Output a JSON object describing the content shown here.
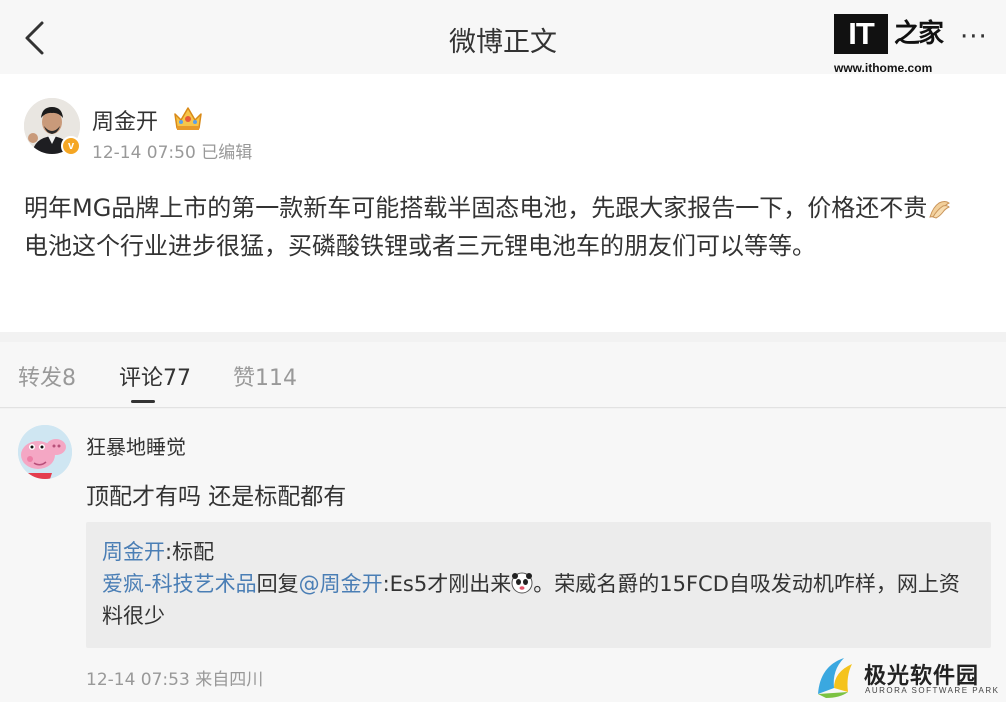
{
  "nav": {
    "title": "微博正文",
    "more_label": "···"
  },
  "watermark_top": {
    "logo_text": "IT",
    "logo_chars": "之家",
    "url": "www.ithome.com"
  },
  "post": {
    "author": "周金开",
    "meta": "12-14 07:50 已编辑",
    "line1": "明年MG品牌上市的第一款新车可能搭载半固态电池，先跟大家报告一下，价格还不贵",
    "line2": "电池这个行业进步很猛，买磷酸铁锂或者三元锂电池车的朋友们可以等等。",
    "verified_badge": "v"
  },
  "tabs": [
    {
      "label": "转发8"
    },
    {
      "label": "评论77"
    },
    {
      "label": "赞114"
    }
  ],
  "comment": {
    "author": "狂暴地睡觉",
    "text": "顶配才有吗 还是标配都有",
    "replies": [
      {
        "user": "周金开",
        "sep": ":",
        "text": "标配"
      },
      {
        "user": "爱疯-科技艺术品",
        "action": "回复",
        "mention": "@周金开",
        "sep": ":",
        "text_before": "Es5才刚出来",
        "text_after": "。荣威名爵的15FCD自吸发动机咋样，网上资料很少"
      }
    ],
    "meta": "12-14 07:53 来自四川"
  },
  "watermark_bottom": {
    "name": "极光软件园",
    "sub": "AURORA SOFTWARE PARK"
  },
  "colors": {
    "link": "#4a7eb5",
    "muted": "#999999",
    "text": "#333333",
    "badge": "#f5a623"
  }
}
